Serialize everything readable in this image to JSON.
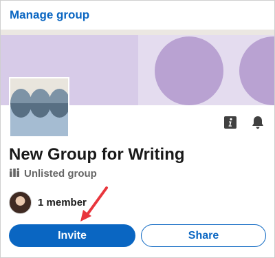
{
  "header": {
    "manage_link": "Manage group"
  },
  "colors": {
    "accent": "#0a66c2",
    "banner": "#e4dcef",
    "arrow": "#e8363d"
  },
  "group": {
    "name": "New Group for Writing",
    "type": "Unlisted group",
    "type_icon": "members-icon",
    "member_count": "1 member"
  },
  "icons": {
    "info": "info-icon",
    "notifications": "bell-icon"
  },
  "actions": {
    "invite_label": "Invite",
    "share_label": "Share"
  }
}
